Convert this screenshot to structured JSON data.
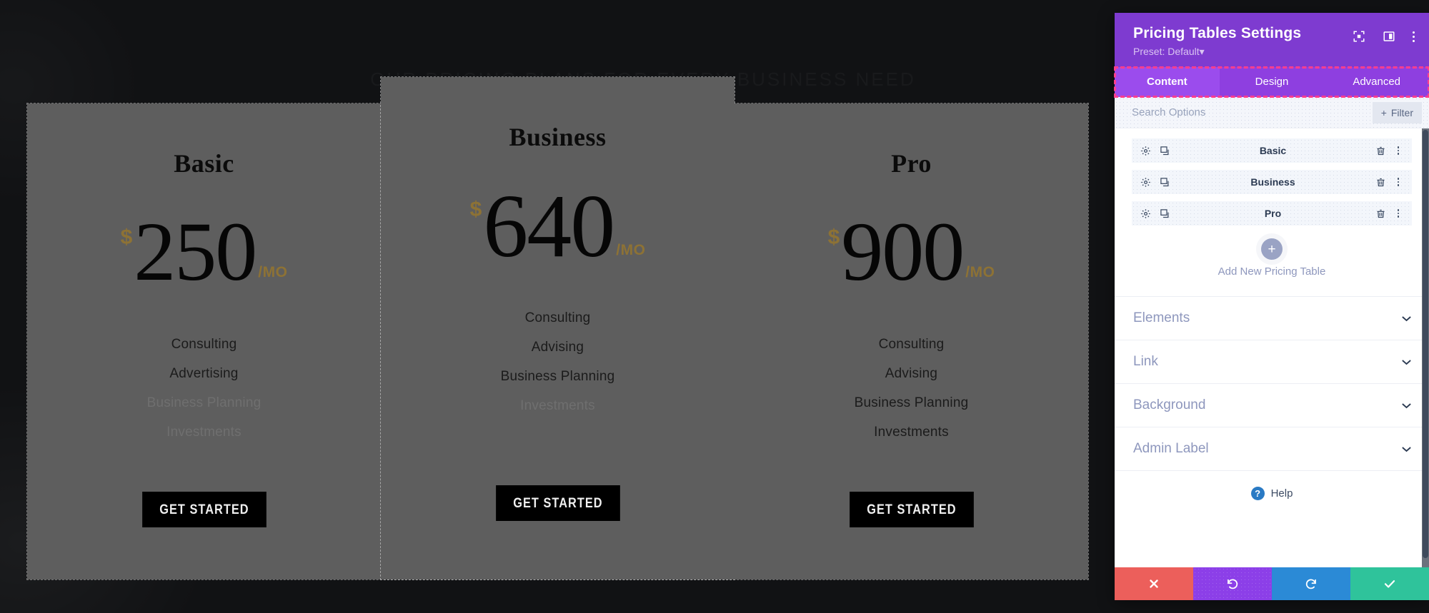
{
  "canvas": {
    "ghost_heading": "OUR PRICING PLANS FOR EVERY BUSINESS NEED",
    "background_color": "#111214",
    "card_background": "#5e5e5e"
  },
  "pricing": {
    "currency_symbol": "$",
    "frequency": "/MO",
    "cta_label": "GET STARTED",
    "accent_color": "#8d7235",
    "tables": [
      {
        "title": "Basic",
        "price": "250",
        "featured": false,
        "features": [
          {
            "label": "Consulting",
            "enabled": true
          },
          {
            "label": "Advertising",
            "enabled": true
          },
          {
            "label": "Business Planning",
            "enabled": false
          },
          {
            "label": "Investments",
            "enabled": false
          }
        ]
      },
      {
        "title": "Business",
        "price": "640",
        "featured": true,
        "features": [
          {
            "label": "Consulting",
            "enabled": true
          },
          {
            "label": "Advising",
            "enabled": true
          },
          {
            "label": "Business Planning",
            "enabled": true
          },
          {
            "label": "Investments",
            "enabled": false
          }
        ]
      },
      {
        "title": "Pro",
        "price": "900",
        "featured": false,
        "features": [
          {
            "label": "Consulting",
            "enabled": true
          },
          {
            "label": "Advising",
            "enabled": true
          },
          {
            "label": "Business Planning",
            "enabled": true
          },
          {
            "label": "Investments",
            "enabled": true
          }
        ]
      }
    ]
  },
  "panel": {
    "title": "Pricing Tables Settings",
    "preset": "Preset: Default",
    "preset_caret": "▾",
    "header_color": "#7e3bd0",
    "highlight_color": "#ff3e8e",
    "icons": {
      "focus": "focus-icon",
      "layout": "layout-view-icon",
      "more": "more-options-icon"
    },
    "tabs": [
      {
        "label": "Content",
        "active": true
      },
      {
        "label": "Design",
        "active": false
      },
      {
        "label": "Advanced",
        "active": false
      }
    ],
    "search": {
      "placeholder": "Search Options",
      "value": "",
      "filter_label": "Filter",
      "filter_plus": "+"
    },
    "items": [
      {
        "label": "Basic"
      },
      {
        "label": "Business"
      },
      {
        "label": "Pro"
      }
    ],
    "add_new": {
      "plus": "+",
      "label": "Add New Pricing Table"
    },
    "accordions": [
      {
        "label": "Elements"
      },
      {
        "label": "Link"
      },
      {
        "label": "Background"
      },
      {
        "label": "Admin Label"
      }
    ],
    "help": {
      "label": "Help",
      "mark": "?"
    },
    "footer": [
      {
        "name": "discard",
        "color": "#ec5f5b"
      },
      {
        "name": "undo",
        "color": "#8c3fe8"
      },
      {
        "name": "redo",
        "color": "#2b8ad6"
      },
      {
        "name": "save",
        "color": "#2fc39b"
      }
    ]
  }
}
